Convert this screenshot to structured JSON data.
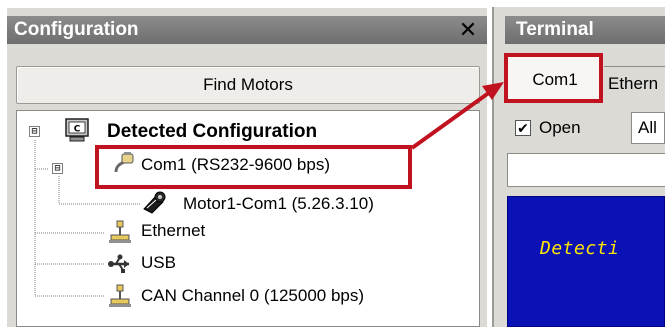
{
  "config_panel": {
    "title": "Configuration",
    "close_glyph": "✕",
    "find_motors_label": "Find Motors"
  },
  "tree": {
    "root": {
      "label": "Detected Configuration",
      "icon": "computer-config-icon",
      "expander": "⊟"
    },
    "com1": {
      "label": "Com1 (RS232-9600 bps)",
      "icon": "serial-port-icon",
      "expander": "⊟"
    },
    "motor": {
      "label": "Motor1-Com1 (5.26.3.10)",
      "icon": "motor-icon"
    },
    "ethernet": {
      "label": "Ethernet",
      "icon": "ethernet-icon"
    },
    "usb": {
      "label": "USB",
      "icon": "usb-icon"
    },
    "can": {
      "label": "CAN Channel 0 (125000 bps)",
      "icon": "can-icon"
    }
  },
  "terminal_panel": {
    "title": "Terminal",
    "tabs": [
      {
        "label": "Com1",
        "active": true
      },
      {
        "label": "Ethern",
        "active": false
      }
    ],
    "open_checkbox": {
      "label": "Open",
      "checked": true,
      "mark": "✔"
    },
    "filter_select_value": "All",
    "command_input_value": "",
    "output_text": "Detecti"
  },
  "colors": {
    "highlight": "#c1121f",
    "terminal_bg": "#0a12b5",
    "terminal_text": "#ffe600",
    "panel_header": "#7d7d7d"
  }
}
